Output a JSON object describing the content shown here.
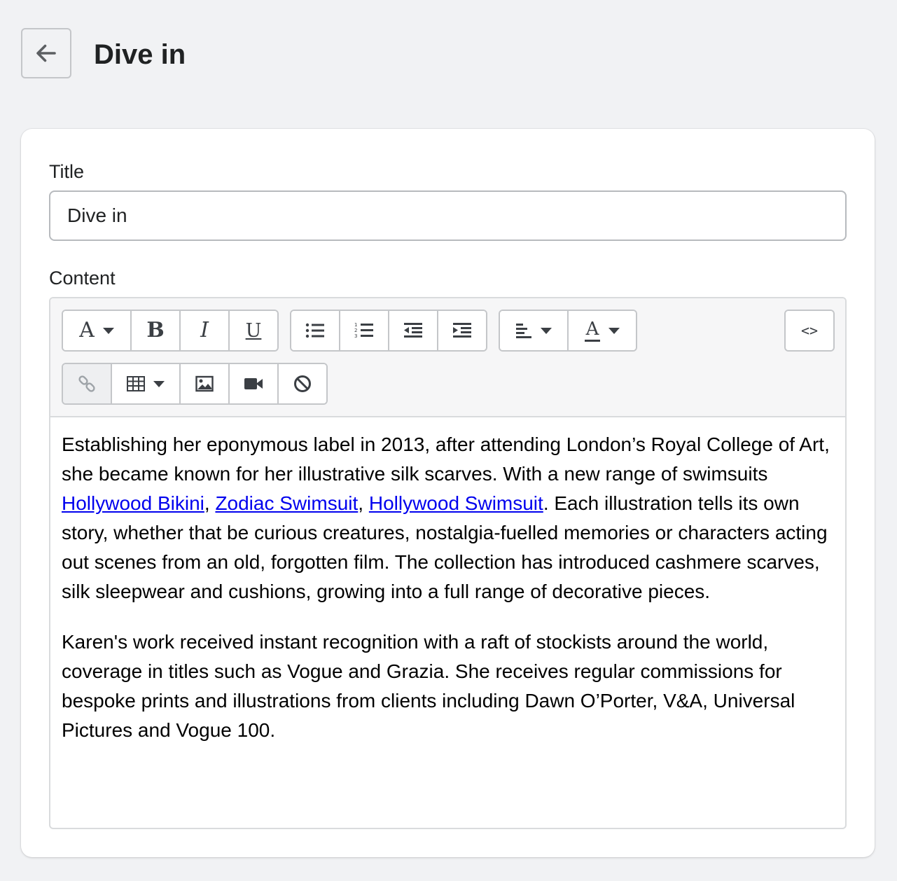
{
  "header": {
    "title": "Dive in",
    "back_icon": "arrow-left-icon"
  },
  "form": {
    "title_label": "Title",
    "title_value": "Dive in",
    "content_label": "Content"
  },
  "toolbar": {
    "icons": [
      "font-icon",
      "bold-icon",
      "italic-icon",
      "underline-icon",
      "bullet-list-icon",
      "numbered-list-icon",
      "outdent-icon",
      "indent-icon",
      "align-left-icon",
      "text-color-icon",
      "html-source-icon",
      "link-icon",
      "table-icon",
      "image-icon",
      "video-icon",
      "clear-format-icon"
    ],
    "font_glyph": "A",
    "bold_glyph": "B",
    "italic_glyph": "I",
    "underline_glyph": "U",
    "text_color_glyph": "A",
    "html_glyph": "<>"
  },
  "content": {
    "p1_text_a": "Establishing her eponymous label in 2013, after attending London’s Royal College of Art, she became known for her illustrative silk scarves. With a new range of swimsuits ",
    "link1": "Hollywood Bikini",
    "sep1": ", ",
    "link2": "Zodiac Swimsuit",
    "sep2": ", ",
    "link3": "Hollywood Swimsuit",
    "p1_text_b": ". Each illustration tells its own story, whether that be curious creatures, nostalgia-fuelled memories or characters acting out scenes from an old, forgotten film. The collection has introduced cashmere scarves, silk sleepwear and cushions, growing into a full range of decorative pieces.",
    "p2": "Karen's work received instant recognition with a raft of stockists around the world, coverage in titles such as Vogue and Grazia. She receives regular commissions for bespoke prints and illustrations from clients including Dawn O’Porter, V&A, Universal Pictures and Vogue 100."
  },
  "colors": {
    "background": "#f1f2f4",
    "link": "#0000ee",
    "toolbar_bg": "#f6f6f7"
  }
}
